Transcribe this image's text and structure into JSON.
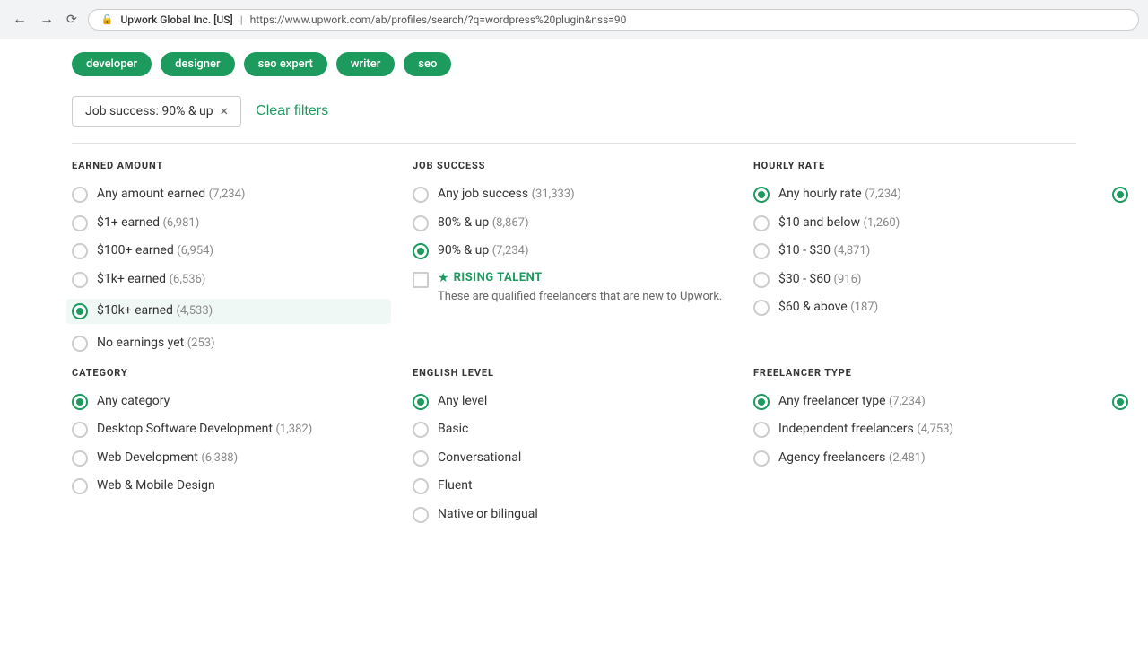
{
  "browser": {
    "lock_label": "🔒",
    "site_name": "Upwork Global Inc. [US]",
    "separator": "|",
    "url": "https://www.upwork.com/ab/profiles/search/?q=wordpress%20plugin&nss=90"
  },
  "tags": [
    {
      "label": "developer"
    },
    {
      "label": "designer"
    },
    {
      "label": "seo expert"
    },
    {
      "label": "writer"
    },
    {
      "label": "seo"
    }
  ],
  "filter_chip": {
    "label": "Job success: 90% & up",
    "close": "×"
  },
  "clear_filters": "Clear filters",
  "sections": {
    "earned_amount": {
      "title": "EARNED AMOUNT",
      "options": [
        {
          "label": "Any amount earned",
          "count": "(7,234)",
          "checked": false
        },
        {
          "label": "$1+ earned",
          "count": "(6,981)",
          "checked": false
        },
        {
          "label": "$100+ earned",
          "count": "(6,954)",
          "checked": false
        },
        {
          "label": "$1k+ earned",
          "count": "(6,536)",
          "checked": false
        },
        {
          "label": "$10k+ earned",
          "count": "(4,533)",
          "checked": true,
          "highlighted": true
        },
        {
          "label": "No earnings yet",
          "count": "(253)",
          "checked": false
        }
      ]
    },
    "job_success": {
      "title": "JOB SUCCESS",
      "options": [
        {
          "label": "Any job success",
          "count": "(31,333)",
          "checked": false
        },
        {
          "label": "80% & up",
          "count": "(8,867)",
          "checked": false
        },
        {
          "label": "90% & up",
          "count": "(7,234)",
          "checked": true
        }
      ],
      "rising_talent": {
        "badge_label": "RISING TALENT",
        "star": "★",
        "description": "These are qualified freelancers that are new to Upwork."
      }
    },
    "hourly_rate": {
      "title": "HOURLY RATE",
      "options": [
        {
          "label": "Any hourly rate",
          "count": "(7,234)",
          "checked": true
        },
        {
          "label": "$10 and below",
          "count": "(1,260)",
          "checked": false
        },
        {
          "label": "$10 - $30",
          "count": "(4,871)",
          "checked": false
        },
        {
          "label": "$30 - $60",
          "count": "(916)",
          "checked": false
        },
        {
          "label": "$60 & above",
          "count": "(187)",
          "checked": false
        }
      ]
    },
    "category": {
      "title": "CATEGORY",
      "options": [
        {
          "label": "Any category",
          "count": "",
          "checked": true
        },
        {
          "label": "Desktop Software Development",
          "count": "(1,382)",
          "checked": false
        },
        {
          "label": "Web Development",
          "count": "(6,388)",
          "checked": false
        },
        {
          "label": "Web & Mobile Design",
          "count": "",
          "checked": false
        }
      ]
    },
    "english_level": {
      "title": "ENGLISH LEVEL",
      "options": [
        {
          "label": "Any level",
          "count": "",
          "checked": true
        },
        {
          "label": "Basic",
          "count": "",
          "checked": false
        },
        {
          "label": "Conversational",
          "count": "",
          "checked": false
        },
        {
          "label": "Fluent",
          "count": "",
          "checked": false
        },
        {
          "label": "Native or bilingual",
          "count": "",
          "checked": false
        }
      ]
    },
    "freelancer_type": {
      "title": "FREELANCER TYPE",
      "options": [
        {
          "label": "Any freelancer type",
          "count": "(7,234)",
          "checked": true
        },
        {
          "label": "Independent freelancers",
          "count": "(4,753)",
          "checked": false
        },
        {
          "label": "Agency freelancers",
          "count": "(2,481)",
          "checked": false
        }
      ]
    }
  }
}
